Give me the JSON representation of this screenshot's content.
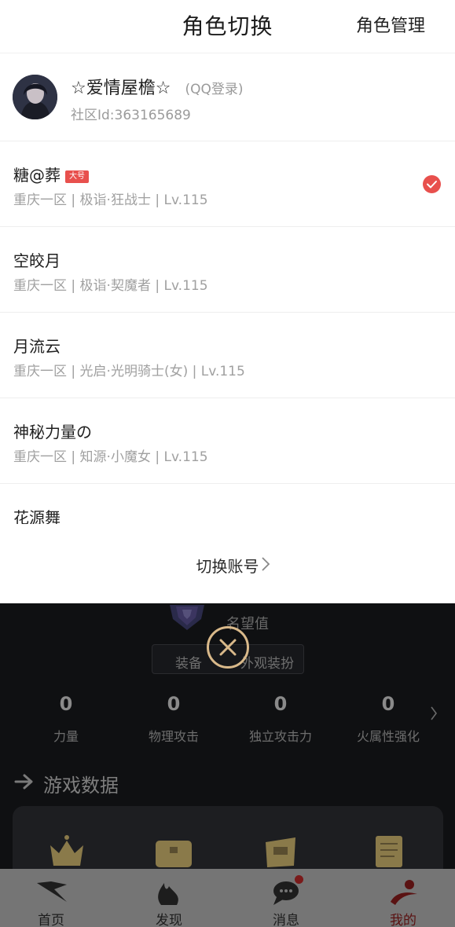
{
  "header": {
    "title": "角色切换",
    "manage_label": "角色管理"
  },
  "account": {
    "name": "☆爱情屋檐☆",
    "login_type": "(QQ登录)",
    "community_id": "社区Id:363165689"
  },
  "roles": [
    {
      "name": "糖@葬",
      "badge": "大号",
      "info": "重庆一区 | 极诣·狂战士 | Lv.115",
      "selected": true
    },
    {
      "name": "空皎月",
      "info": "重庆一区 | 极诣·契魔者 | Lv.115"
    },
    {
      "name": "月流云",
      "info": "重庆一区 | 光启·光明骑士(女) | Lv.115"
    },
    {
      "name": "神秘力量の",
      "info": "重庆一区 | 知源·小魔女 | Lv.115"
    },
    {
      "name": "花源舞",
      "info": ""
    }
  ],
  "switch_account_label": "切换账号",
  "background": {
    "reputation_label": "名望值",
    "tabs": [
      "装备",
      "外观装扮"
    ],
    "stats": [
      {
        "value": "0",
        "label": "力量"
      },
      {
        "value": "0",
        "label": "物理攻击"
      },
      {
        "value": "0",
        "label": "独立攻击力"
      },
      {
        "value": "0",
        "label": "火属性强化"
      }
    ],
    "section_title": "游戏数据"
  },
  "nav": {
    "items": [
      {
        "label": "首页",
        "icon": "home-wing-icon"
      },
      {
        "label": "发现",
        "icon": "discover-flame-icon"
      },
      {
        "label": "消息",
        "icon": "message-chat-icon",
        "badge_dot": true
      },
      {
        "label": "我的",
        "icon": "profile-icon",
        "active": true
      }
    ]
  },
  "colors": {
    "accent_red": "#e8504d",
    "close_ring": "#d9b98a",
    "nav_bar": "#757575"
  }
}
